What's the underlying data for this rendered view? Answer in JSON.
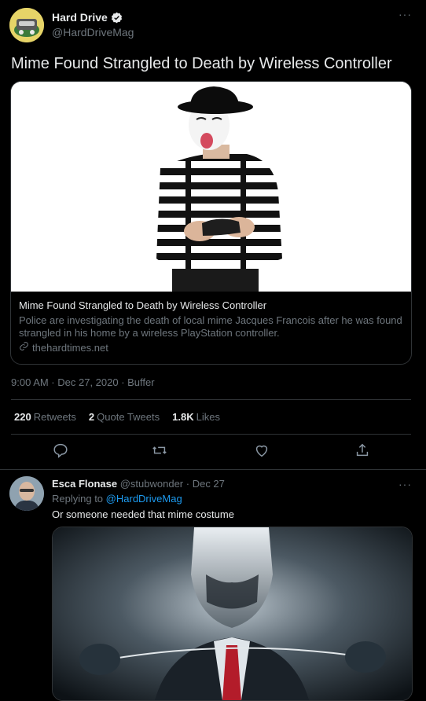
{
  "tweet": {
    "author_name": "Hard Drive",
    "author_handle": "@HardDriveMag",
    "text": "Mime Found Strangled to Death by Wireless Controller",
    "more": "···",
    "card": {
      "title": "Mime Found Strangled to Death by Wireless Controller",
      "description": "Police are investigating the death of local mime Jacques Francois after he was found strangled in his home by a wireless PlayStation controller.",
      "domain": "thehardtimes.net"
    },
    "timestamp": "9:00 AM · Dec 27, 2020 · Buffer",
    "stats": {
      "retweets_count": "220",
      "retweets_label": "Retweets",
      "quotes_count": "2",
      "quotes_label": "Quote Tweets",
      "likes_count": "1.8K",
      "likes_label": "Likes"
    }
  },
  "reply": {
    "author_name": "Esca Flonase",
    "author_handle": "@stubwonder",
    "date": "· Dec 27",
    "replying_prefix": "Replying to",
    "replying_handle": "@HardDriveMag",
    "text": "Or someone needed that mime costume",
    "more": "···"
  },
  "colors": {
    "background": "#000000",
    "text": "#e7e9ea",
    "muted": "#6e767d",
    "link": "#1d9bf0",
    "border": "#2f3336"
  },
  "icons": [
    "verified-badge-icon",
    "more-icon",
    "link-icon",
    "reply-icon",
    "retweet-icon",
    "like-icon",
    "share-icon"
  ]
}
